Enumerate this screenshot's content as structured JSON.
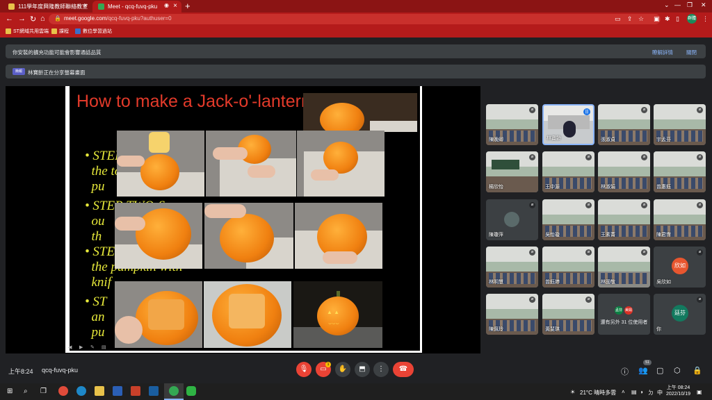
{
  "browser": {
    "tabs": [
      {
        "title": "111學年度興隆教師聯絡教室",
        "favicon_color": "#e8c24a"
      },
      {
        "title": "Meet - qcq-fuvq-pku",
        "favicon_color": "#34a853"
      }
    ],
    "new_tab": "+",
    "url_host": "meet.google.com",
    "url_path": "/qcq-fuvq-pku?authuser=0",
    "profile": "群體",
    "bookmarks": [
      "ST網域共用雲端",
      "課程",
      "數位學習過站"
    ]
  },
  "notices": {
    "extension_warning": "你安裝的擴充功能可能會影響通話品質",
    "extension_detail": "瞭解詳情",
    "dismiss": "關閉",
    "presenting_badge": "簡報",
    "presenting_text": "林寶齡正在分享螢幕畫面"
  },
  "slide": {
    "title": "How to make a Jack-o'-lanternn",
    "steps": [
      "STEP ONE:",
      "the top of the",
      "pu",
      "STEP TWO:Scoop",
      "ou",
      "th",
      "STE",
      "the pumpkin with",
      "knif",
      "ST",
      "an",
      "pu"
    ]
  },
  "participants": [
    {
      "name": "陳晚卿",
      "state": "muted"
    },
    {
      "name": "林寶齡",
      "state": "speaking"
    },
    {
      "name": "張淑貞",
      "state": "muted"
    },
    {
      "name": "宇孟芬",
      "state": "muted"
    },
    {
      "name": "楊欣怡",
      "state": "muted"
    },
    {
      "name": "王中源",
      "state": "muted"
    },
    {
      "name": "林淑娟",
      "state": "muted"
    },
    {
      "name": "曾惠鈺",
      "state": "muted"
    },
    {
      "name": "陳瓊萍",
      "state": "muted"
    },
    {
      "name": "吳怡璇",
      "state": "muted"
    },
    {
      "name": "王素菁",
      "state": "muted"
    },
    {
      "name": "陳君霈",
      "state": "muted"
    },
    {
      "name": "林明慧",
      "state": "muted"
    },
    {
      "name": "曾鈺婷",
      "state": "muted"
    },
    {
      "name": "林國敬",
      "state": "muted"
    },
    {
      "name": "吳欣如",
      "state": "muted",
      "initials": "欣如"
    },
    {
      "name": "陳佩玲",
      "state": "muted"
    },
    {
      "name": "黃斐琪",
      "state": "muted"
    },
    {
      "name": "還有另外 31 位使用者",
      "state": "group",
      "minis": [
        "孟芬",
        "美娟"
      ]
    },
    {
      "name": "你",
      "state": "muted",
      "initials": "廷芬"
    }
  ],
  "meeting": {
    "time": "上午8:24",
    "code": "qcq-fuvq-pku",
    "participant_count": "51",
    "hand_badge": "1"
  },
  "taskbar": {
    "weather": "21°C 晴時多雲",
    "ime": "中",
    "time": "上午 08:24",
    "date": "2022/10/19"
  },
  "colors": {
    "browser_red": "#b41b1b",
    "meet_bg": "#202124",
    "end_call": "#ea4335",
    "slide_title": "#e23a2a",
    "slide_text": "#e6e83a"
  }
}
